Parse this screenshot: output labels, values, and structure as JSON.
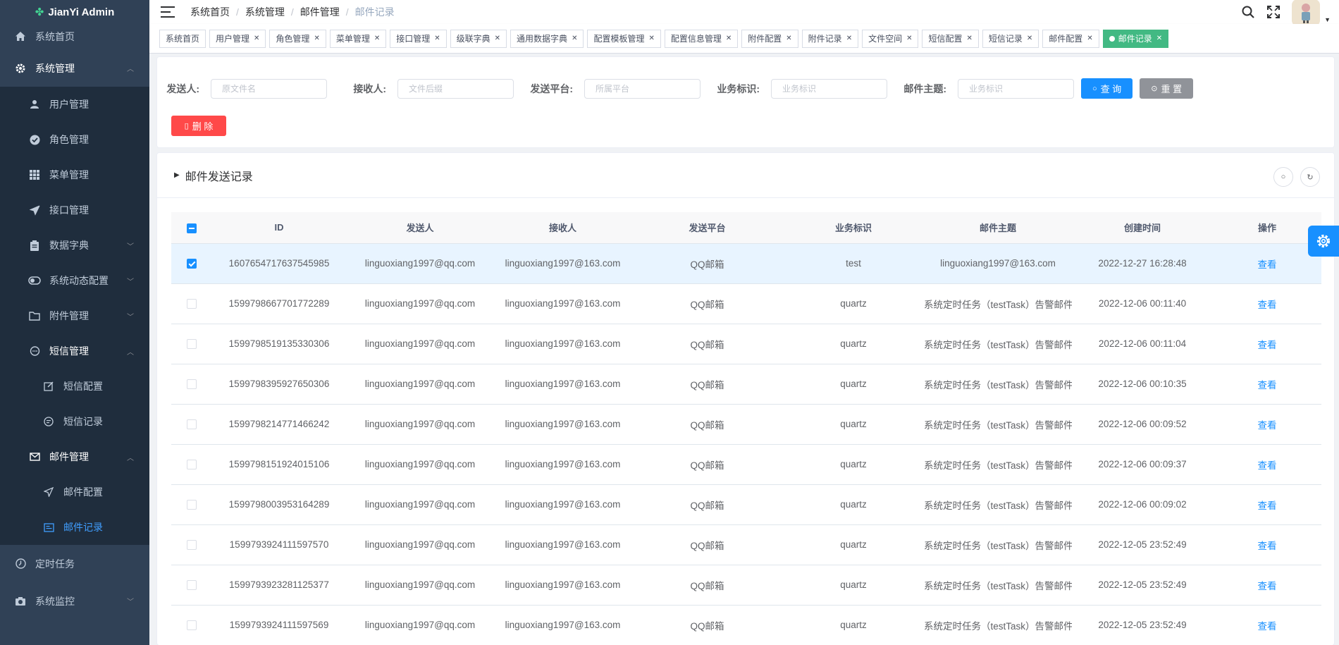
{
  "app": {
    "title": "JianYi Admin"
  },
  "sidebar": {
    "items": [
      {
        "label": "系统首页",
        "icon": "home-icon"
      },
      {
        "label": "系统管理",
        "icon": "gear-icon",
        "open": true
      },
      {
        "label": "用户管理",
        "icon": "user-icon"
      },
      {
        "label": "角色管理",
        "icon": "check-circle-icon"
      },
      {
        "label": "菜单管理",
        "icon": "grid-icon"
      },
      {
        "label": "接口管理",
        "icon": "send-icon"
      },
      {
        "label": "数据字典",
        "icon": "clipboard-icon"
      },
      {
        "label": "系统动态配置",
        "icon": "toggle-icon"
      },
      {
        "label": "附件管理",
        "icon": "folder-icon"
      },
      {
        "label": "短信管理",
        "icon": "chat-icon",
        "open": true
      },
      {
        "label": "短信配置",
        "icon": "edit-icon"
      },
      {
        "label": "短信记录",
        "icon": "message-icon"
      },
      {
        "label": "邮件管理",
        "icon": "mail-icon",
        "open": true
      },
      {
        "label": "邮件配置",
        "icon": "send-icon"
      },
      {
        "label": "邮件记录",
        "icon": "list-icon",
        "active": true
      },
      {
        "label": "定时任务",
        "icon": "clock-icon"
      },
      {
        "label": "系统监控",
        "icon": "camera-icon"
      }
    ]
  },
  "breadcrumb": [
    "系统首页",
    "系统管理",
    "邮件管理",
    "邮件记录"
  ],
  "tags": [
    {
      "label": "系统首页",
      "closable": false
    },
    {
      "label": "用户管理",
      "closable": true
    },
    {
      "label": "角色管理",
      "closable": true
    },
    {
      "label": "菜单管理",
      "closable": true
    },
    {
      "label": "接口管理",
      "closable": true
    },
    {
      "label": "级联字典",
      "closable": true
    },
    {
      "label": "通用数据字典",
      "closable": true
    },
    {
      "label": "配置模板管理",
      "closable": true
    },
    {
      "label": "配置信息管理",
      "closable": true
    },
    {
      "label": "附件配置",
      "closable": true
    },
    {
      "label": "附件记录",
      "closable": true
    },
    {
      "label": "文件空间",
      "closable": true
    },
    {
      "label": "短信配置",
      "closable": true
    },
    {
      "label": "短信记录",
      "closable": true
    },
    {
      "label": "邮件配置",
      "closable": true
    },
    {
      "label": "邮件记录",
      "closable": true,
      "active": true
    }
  ],
  "search": {
    "fields": [
      {
        "label": "发送人:",
        "placeholder": "原文件名"
      },
      {
        "label": "接收人:",
        "placeholder": "文件后缀"
      },
      {
        "label": "发送平台:",
        "placeholder": "所属平台"
      },
      {
        "label": "业务标识:",
        "placeholder": "业务标识"
      },
      {
        "label": "邮件主题:",
        "placeholder": "业务标识"
      }
    ],
    "query_label": "查 询",
    "reset_label": "重 置",
    "delete_label": "删 除"
  },
  "table": {
    "title": "邮件发送记录",
    "columns": [
      "ID",
      "发送人",
      "接收人",
      "发送平台",
      "业务标识",
      "邮件主题",
      "创建时间",
      "操作"
    ],
    "rows": [
      {
        "id": "1607654717637545985",
        "sender": "linguoxiang1997@qq.com",
        "receiver": "linguoxiang1997@163.com",
        "platform": "QQ邮箱",
        "biz": "test",
        "subject": "linguoxiang1997@163.com",
        "time": "2022-12-27 16:28:48",
        "action": "查看",
        "selected": true
      },
      {
        "id": "1599798667701772289",
        "sender": "linguoxiang1997@qq.com",
        "receiver": "linguoxiang1997@163.com",
        "platform": "QQ邮箱",
        "biz": "quartz",
        "subject": "系统定时任务（testTask）告警邮件",
        "time": "2022-12-06 00:11:40",
        "action": "查看",
        "selected": false
      },
      {
        "id": "1599798519135330306",
        "sender": "linguoxiang1997@qq.com",
        "receiver": "linguoxiang1997@163.com",
        "platform": "QQ邮箱",
        "biz": "quartz",
        "subject": "系统定时任务（testTask）告警邮件",
        "time": "2022-12-06 00:11:04",
        "action": "查看",
        "selected": false
      },
      {
        "id": "1599798395927650306",
        "sender": "linguoxiang1997@qq.com",
        "receiver": "linguoxiang1997@163.com",
        "platform": "QQ邮箱",
        "biz": "quartz",
        "subject": "系统定时任务（testTask）告警邮件",
        "time": "2022-12-06 00:10:35",
        "action": "查看",
        "selected": false
      },
      {
        "id": "1599798214771466242",
        "sender": "linguoxiang1997@qq.com",
        "receiver": "linguoxiang1997@163.com",
        "platform": "QQ邮箱",
        "biz": "quartz",
        "subject": "系统定时任务（testTask）告警邮件",
        "time": "2022-12-06 00:09:52",
        "action": "查看",
        "selected": false
      },
      {
        "id": "1599798151924015106",
        "sender": "linguoxiang1997@qq.com",
        "receiver": "linguoxiang1997@163.com",
        "platform": "QQ邮箱",
        "biz": "quartz",
        "subject": "系统定时任务（testTask）告警邮件",
        "time": "2022-12-06 00:09:37",
        "action": "查看",
        "selected": false
      },
      {
        "id": "1599798003953164289",
        "sender": "linguoxiang1997@qq.com",
        "receiver": "linguoxiang1997@163.com",
        "platform": "QQ邮箱",
        "biz": "quartz",
        "subject": "系统定时任务（testTask）告警邮件",
        "time": "2022-12-06 00:09:02",
        "action": "查看",
        "selected": false
      },
      {
        "id": "1599793924111597570",
        "sender": "linguoxiang1997@qq.com",
        "receiver": "linguoxiang1997@163.com",
        "platform": "QQ邮箱",
        "biz": "quartz",
        "subject": "系统定时任务（testTask）告警邮件",
        "time": "2022-12-05 23:52:49",
        "action": "查看",
        "selected": false
      },
      {
        "id": "1599793923281125377",
        "sender": "linguoxiang1997@qq.com",
        "receiver": "linguoxiang1997@163.com",
        "platform": "QQ邮箱",
        "biz": "quartz",
        "subject": "系统定时任务（testTask）告警邮件",
        "time": "2022-12-05 23:52:49",
        "action": "查看",
        "selected": false
      },
      {
        "id": "1599793924111597569",
        "sender": "linguoxiang1997@qq.com",
        "receiver": "linguoxiang1997@163.com",
        "platform": "QQ邮箱",
        "biz": "quartz",
        "subject": "系统定时任务（testTask）告警邮件",
        "time": "2022-12-05 23:52:49",
        "action": "查看",
        "selected": false
      }
    ]
  },
  "colors": {
    "sidebar_bg": "#304156",
    "submenu_bg": "#1f2d3d",
    "primary": "#1890ff",
    "tag_active": "#42b983",
    "danger": "#ff4949",
    "info": "#909399",
    "row_selected": "#e8f4ff"
  }
}
